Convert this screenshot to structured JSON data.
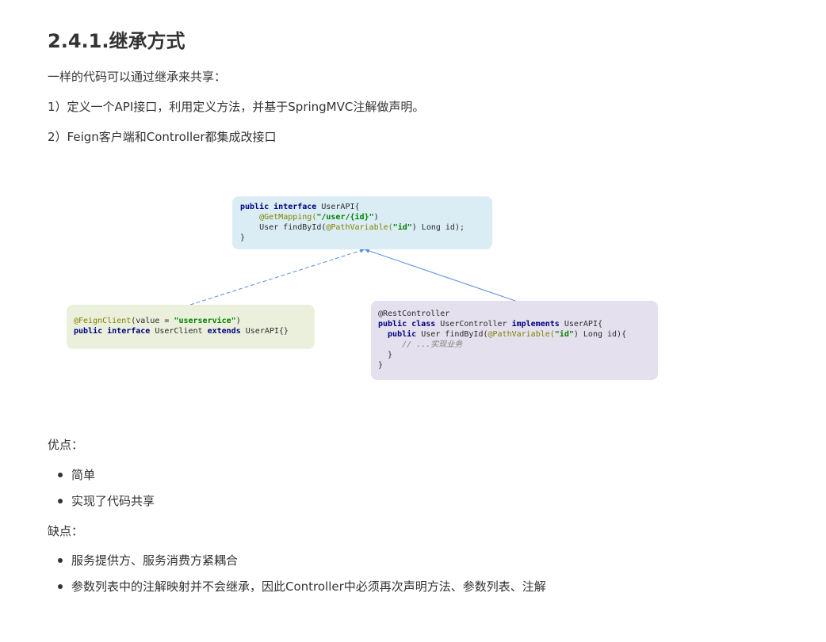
{
  "heading": "2.4.1.继承方式",
  "intro": "一样的代码可以通过继承来共享：",
  "steps": [
    "1）定义一个API接口，利用定义方法，并基于SpringMVC注解做声明。",
    "2）Feign客户端和Controller都集成改接口"
  ],
  "diagram": {
    "api_box": {
      "line1_kw": "public interface",
      "line1_rest": " UserAPI{",
      "line2_ann": "@GetMapping(",
      "line2_str": "\"/user/{id}\"",
      "line2_end": ")",
      "line3_a": "    User findById(",
      "line3_ann": "@PathVariable(",
      "line3_str": "\"id\"",
      "line3_end": ") Long id);",
      "line4": "}"
    },
    "client_box": {
      "line1_ann": "@FeignClient",
      "line1_mid": "(value = ",
      "line1_str": "\"userservice\"",
      "line1_end": ")",
      "line2_kw1": "public interface",
      "line2_mid": " UserClient ",
      "line2_kw2": "extends",
      "line2_end": " UserAPI{}"
    },
    "controller_box": {
      "line1": "@RestController",
      "line2_kw1": "public class",
      "line2_mid": " UserController ",
      "line2_kw2": "implements",
      "line2_end": " UserAPI{",
      "line3_kw": "  public",
      "line3_a": " User findById(",
      "line3_ann": "@PathVariable(",
      "line3_str": "\"id\"",
      "line3_end": ") Long id){",
      "line4_cmt": "     // ...实现业务",
      "line5": "  }",
      "line6": "}"
    }
  },
  "pros_label": "优点：",
  "pros": [
    "简单",
    "实现了代码共享"
  ],
  "cons_label": "缺点：",
  "cons": [
    "服务提供方、服务消费方紧耦合",
    "参数列表中的注解映射并不会继承，因此Controller中必须再次声明方法、参数列表、注解"
  ],
  "colors": {
    "api_box_bg": "#daedf4",
    "client_box_bg": "#eaf0dc",
    "controller_box_bg": "#e4e0ee",
    "arrow": "#5b8fd8"
  }
}
